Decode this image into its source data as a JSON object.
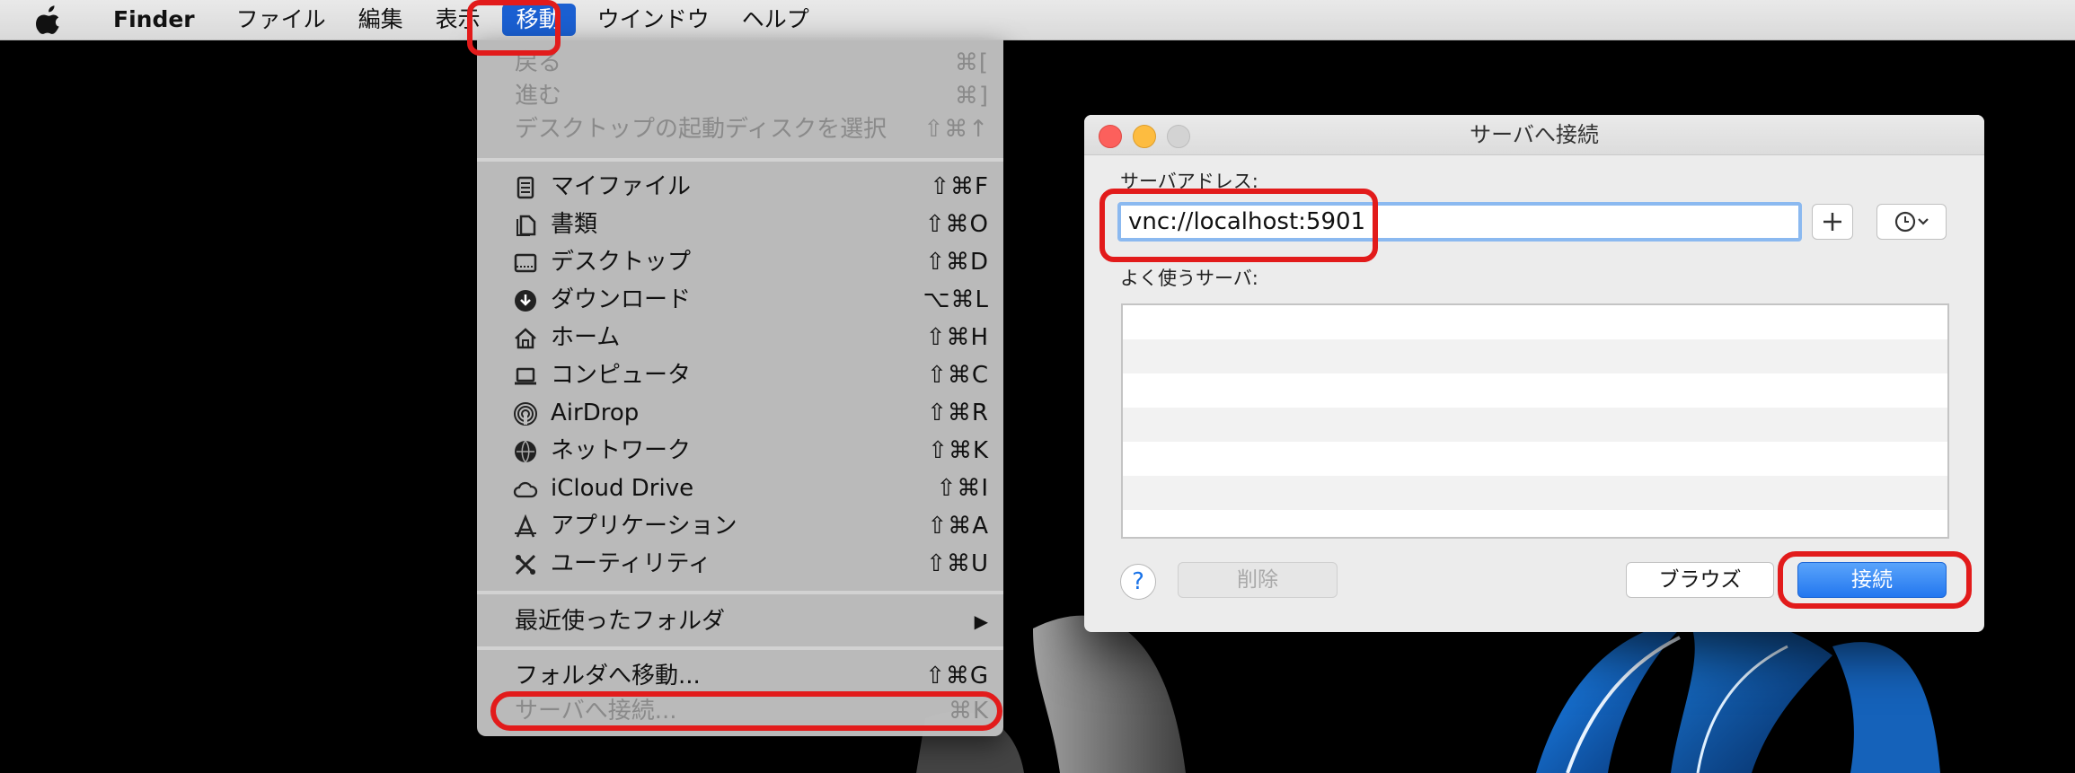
{
  "menubar": {
    "app_name": "Finder",
    "items": [
      "ファイル",
      "編集",
      "表示",
      "移動",
      "ウインドウ",
      "ヘルプ"
    ]
  },
  "go_menu": {
    "back": {
      "label": "戻る",
      "shortcut": "⌘["
    },
    "forward": {
      "label": "進む",
      "shortcut": "⌘]"
    },
    "startup_disk": {
      "label": "デスクトップの起動ディスクを選択",
      "shortcut": "⇧⌘↑"
    },
    "places": [
      {
        "label": "マイファイル",
        "shortcut": "⇧⌘F"
      },
      {
        "label": "書類",
        "shortcut": "⇧⌘O"
      },
      {
        "label": "デスクトップ",
        "shortcut": "⇧⌘D"
      },
      {
        "label": "ダウンロード",
        "shortcut": "⌥⌘L"
      },
      {
        "label": "ホーム",
        "shortcut": "⇧⌘H"
      },
      {
        "label": "コンピュータ",
        "shortcut": "⇧⌘C"
      },
      {
        "label": "AirDrop",
        "shortcut": "⇧⌘R"
      },
      {
        "label": "ネットワーク",
        "shortcut": "⇧⌘K"
      },
      {
        "label": "iCloud Drive",
        "shortcut": "⇧⌘I"
      },
      {
        "label": "アプリケーション",
        "shortcut": "⇧⌘A"
      },
      {
        "label": "ユーティリティ",
        "shortcut": "⇧⌘U"
      }
    ],
    "recent_folders": {
      "label": "最近使ったフォルダ",
      "arrow": "▶"
    },
    "go_to_folder": {
      "label": "フォルダへ移動...",
      "shortcut": "⇧⌘G"
    },
    "connect_server": {
      "label": "サーバへ接続...",
      "shortcut": "⌘K"
    }
  },
  "dialog": {
    "title": "サーバへ接続",
    "address_label": "サーバアドレス:",
    "address_value": "vnc://localhost:5901",
    "favorites_label": "よく使うサーバ:",
    "plus": "+",
    "help": "?",
    "delete": "削除",
    "browse": "ブラウズ",
    "connect": "接続"
  },
  "colors": {
    "selection_blue": "#1a5fd1",
    "annotation_red": "#e21b1b",
    "primary_button": "#2377ef"
  }
}
